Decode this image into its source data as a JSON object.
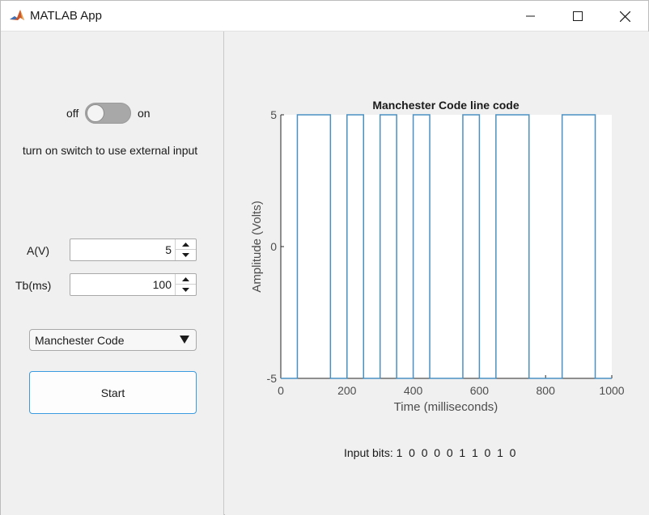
{
  "window": {
    "title": "MATLAB App",
    "icon": "matlab-logo-icon",
    "controls": [
      "minimize-icon",
      "maximize-icon",
      "close-icon"
    ]
  },
  "switch": {
    "off_label": "off",
    "on_label": "on",
    "state": "off",
    "hint": "turn on switch to use external input"
  },
  "amplitude": {
    "label": "A(V)",
    "value": "5"
  },
  "bit_time": {
    "label": "Tb(ms)",
    "value": "100"
  },
  "line_code_select": {
    "selected": "Manchester Code"
  },
  "start_button": {
    "label": "Start"
  },
  "input_bits": {
    "label": "Input bits:",
    "bits": "1  0  0  0  0  1  1  0  1  0"
  },
  "colors": {
    "signal": "#4a90c2",
    "accent": "#3b9be0",
    "panel": "#f0f0f0"
  },
  "chart_data": {
    "type": "line",
    "title": "Manchester Code line code",
    "xlabel": "Time (milliseconds)",
    "ylabel": "Amplitude (Volts)",
    "xlim": [
      0,
      1000
    ],
    "ylim": [
      -5,
      5
    ],
    "xticks": [
      0,
      200,
      400,
      600,
      800,
      1000
    ],
    "yticks": [
      -5,
      0,
      5
    ],
    "grid": false,
    "series": [
      {
        "x": [
          0,
          50,
          50,
          150,
          150,
          200,
          200,
          250,
          250,
          300,
          300,
          350,
          350,
          400,
          400,
          450,
          450,
          550,
          550,
          600,
          600,
          650,
          650,
          750,
          750,
          850,
          850,
          950,
          950,
          1000
        ],
        "values": [
          -5,
          -5,
          5,
          5,
          -5,
          -5,
          5,
          5,
          -5,
          -5,
          5,
          5,
          -5,
          -5,
          5,
          5,
          -5,
          -5,
          5,
          5,
          -5,
          -5,
          5,
          5,
          -5,
          -5,
          5,
          5,
          -5,
          -5
        ]
      }
    ]
  }
}
